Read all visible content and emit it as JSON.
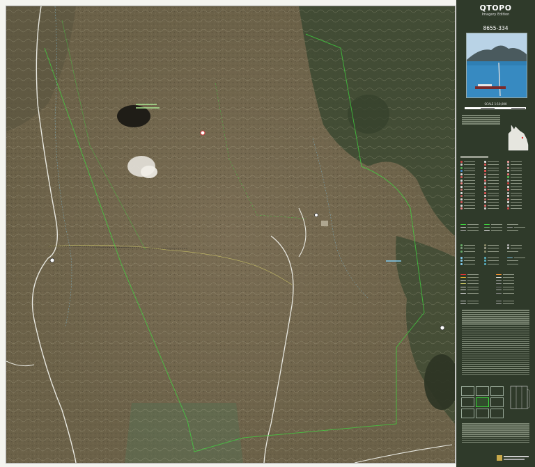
{
  "panel": {
    "title": "QTOPO",
    "subtitle": "Imagery Edition",
    "sheet_number": "8655-334",
    "scale_label": "SCALE 1:10,000"
  },
  "colors": {
    "panel_bg": "#2f3a2a",
    "imagery_base": "#6b6148",
    "forest": "#3e4a33",
    "boundary_line": "#3fdc3f",
    "road": "#e8e8e0",
    "contour": "#c9c2a8",
    "water": "#7fc6e6"
  },
  "icons": {
    "airfield": "plane-icon",
    "homestead": "house-icon",
    "landmark": "point-of-interest-icon"
  }
}
